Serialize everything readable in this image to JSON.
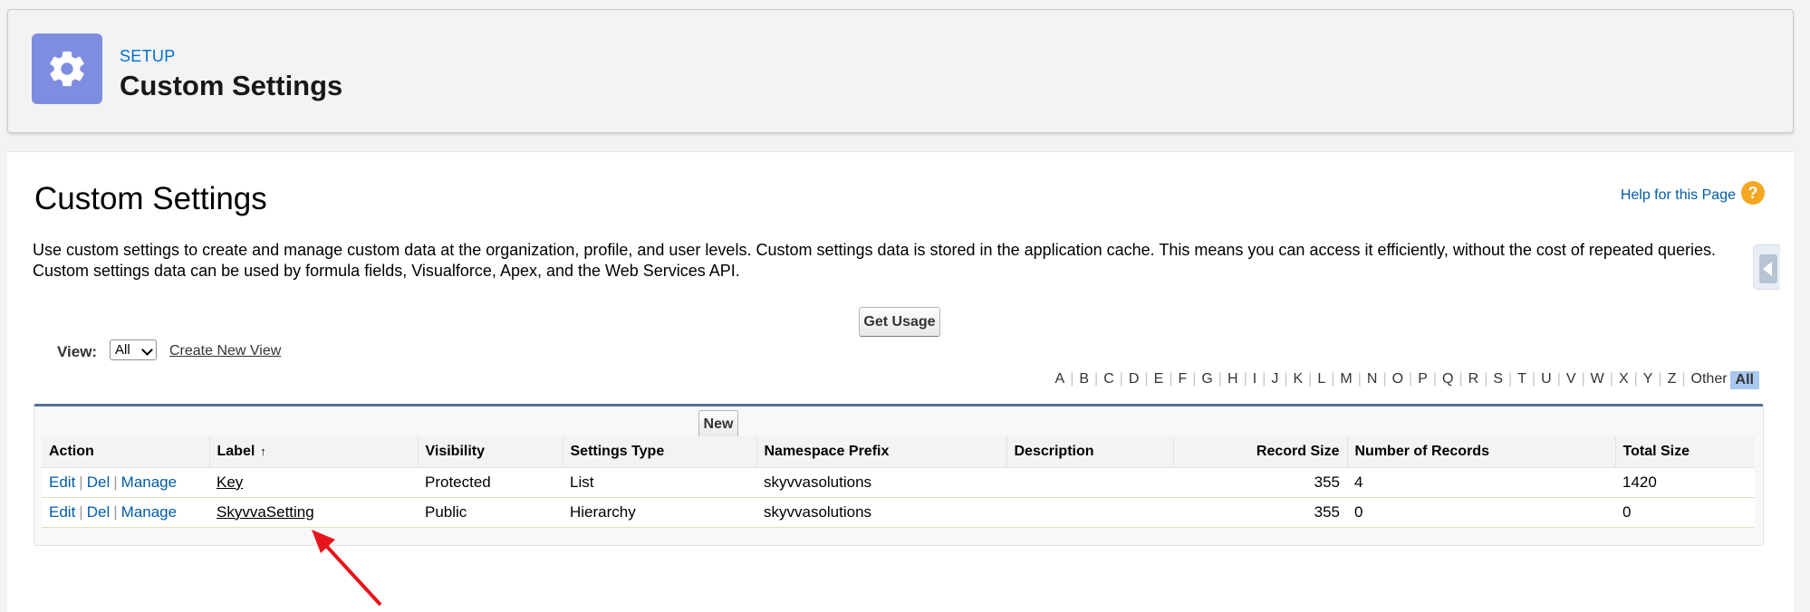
{
  "header": {
    "eyebrow": "SETUP",
    "title": "Custom Settings",
    "icon": "gear-icon"
  },
  "page": {
    "title": "Custom Settings",
    "help_link": "Help for this Page",
    "help_icon_glyph": "?",
    "description": "Use custom settings to create and manage custom data at the organization, profile, and user levels. Custom settings data is stored in the application cache. This means you can access it efficiently, without the cost of repeated queries. Custom settings data can be used by formula fields, Visualforce, Apex, and the Web Services API."
  },
  "toolbar": {
    "get_usage_label": "Get Usage",
    "view_label": "View:",
    "view_selected": "All",
    "create_view_label": "Create New View",
    "new_label": "New"
  },
  "alphabet": [
    "A",
    "B",
    "C",
    "D",
    "E",
    "F",
    "G",
    "H",
    "I",
    "J",
    "K",
    "L",
    "M",
    "N",
    "O",
    "P",
    "Q",
    "R",
    "S",
    "T",
    "U",
    "V",
    "W",
    "X",
    "Y",
    "Z",
    "Other",
    "All"
  ],
  "alphabet_active": "All",
  "table": {
    "columns": [
      "Action",
      "Label",
      "Visibility",
      "Settings Type",
      "Namespace Prefix",
      "Description",
      "Record Size",
      "Number of Records",
      "Total Size"
    ],
    "sort_indicator": "↑",
    "rows": [
      {
        "actions": [
          "Edit",
          "Del",
          "Manage"
        ],
        "label": "Key",
        "visibility": "Protected",
        "settings_type": "List",
        "namespace": "skyvvasolutions",
        "description": "",
        "record_size": "355",
        "num_records": "4",
        "total_size": "1420"
      },
      {
        "actions": [
          "Edit",
          "Del",
          "Manage"
        ],
        "label": "SkyvvaSetting",
        "visibility": "Public",
        "settings_type": "Hierarchy",
        "namespace": "skyvvasolutions",
        "description": "",
        "record_size": "355",
        "num_records": "0",
        "total_size": "0"
      }
    ]
  },
  "colors": {
    "accent": "#7f8de1",
    "link": "#015ba7",
    "annotation_arrow": "#e8141b"
  }
}
